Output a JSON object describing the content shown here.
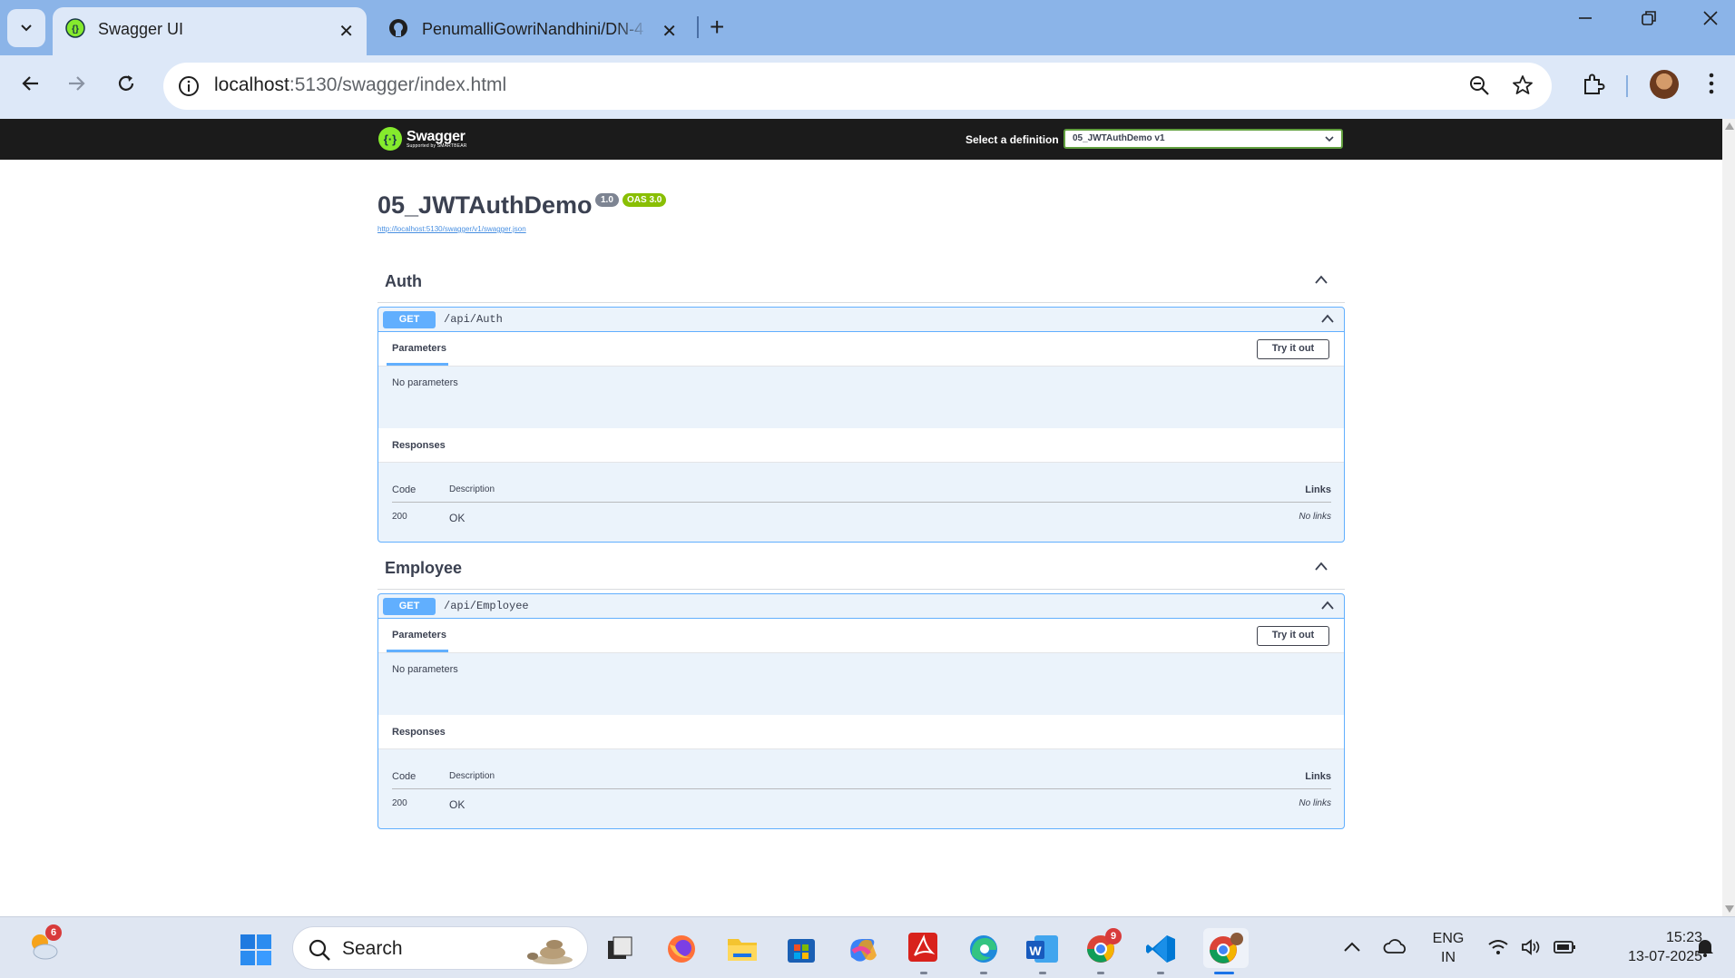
{
  "browser": {
    "tabs": [
      {
        "title": "Swagger UI",
        "active": true
      },
      {
        "title": "PenumalliGowriNandhini/DN-4",
        "active": false
      }
    ],
    "url_host": "localhost",
    "url_rest": ":5130/swagger/index.html"
  },
  "swagger": {
    "logo_main": "Swagger",
    "logo_sub": "Supported by SMARTBEAR",
    "select_label": "Select a definition",
    "selected_definition": "05_JWTAuthDemo v1",
    "api_title": "05_JWTAuthDemo",
    "version_badge": "1.0",
    "oas_badge": "OAS 3.0",
    "spec_url": "http://localhost:5130/swagger/v1/swagger.json",
    "sections": [
      {
        "tag": "Auth",
        "method": "GET",
        "path": "/api/Auth",
        "parameters_tab": "Parameters",
        "try_button": "Try it out",
        "no_params": "No parameters",
        "responses_label": "Responses",
        "col_code": "Code",
        "col_desc": "Description",
        "col_links": "Links",
        "rows": [
          {
            "code": "200",
            "desc": "OK",
            "links": "No links"
          }
        ]
      },
      {
        "tag": "Employee",
        "method": "GET",
        "path": "/api/Employee",
        "parameters_tab": "Parameters",
        "try_button": "Try it out",
        "no_params": "No parameters",
        "responses_label": "Responses",
        "col_code": "Code",
        "col_desc": "Description",
        "col_links": "Links",
        "rows": [
          {
            "code": "200",
            "desc": "OK",
            "links": "No links"
          }
        ]
      }
    ]
  },
  "taskbar": {
    "weather_badge": "6",
    "search_label": "Search",
    "chrome_badge": "9",
    "lang_line1": "ENG",
    "lang_line2": "IN",
    "time": "15:23",
    "date": "13-07-2025"
  },
  "colors": {
    "get_blue": "#61affe",
    "swagger_green": "#89bf04",
    "topbar": "#1b1b1b"
  }
}
